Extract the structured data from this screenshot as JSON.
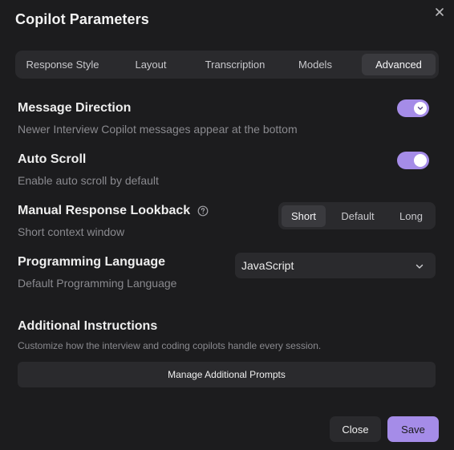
{
  "dialog": {
    "title": "Copilot Parameters"
  },
  "tabs": [
    {
      "label": "Response Style"
    },
    {
      "label": "Layout"
    },
    {
      "label": "Transcription"
    },
    {
      "label": "Models"
    },
    {
      "label": "Advanced",
      "active": true
    }
  ],
  "settings": {
    "message_direction": {
      "title": "Message Direction",
      "description": "Newer Interview Copilot messages appear at the bottom",
      "enabled": true
    },
    "auto_scroll": {
      "title": "Auto Scroll",
      "description": "Enable auto scroll by default",
      "enabled": true
    },
    "lookback": {
      "title": "Manual Response Lookback",
      "description": "Short context window",
      "options": [
        "Short",
        "Default",
        "Long"
      ],
      "selected": "Short"
    },
    "programming_language": {
      "title": "Programming Language",
      "description": "Default Programming Language",
      "value": "JavaScript"
    },
    "additional_instructions": {
      "title": "Additional Instructions",
      "description": "Customize how the interview and coding copilots handle every session.",
      "button_label": "Manage Additional Prompts"
    }
  },
  "footer": {
    "close_label": "Close",
    "save_label": "Save"
  },
  "colors": {
    "accent": "#a58ce8",
    "background": "#1c1c1e",
    "surface": "#2a2a2d",
    "active_segment": "#3a3a3e"
  },
  "icons": {
    "close": "close-icon",
    "help": "help-circle-icon",
    "chevron": "chevron-down-icon"
  }
}
